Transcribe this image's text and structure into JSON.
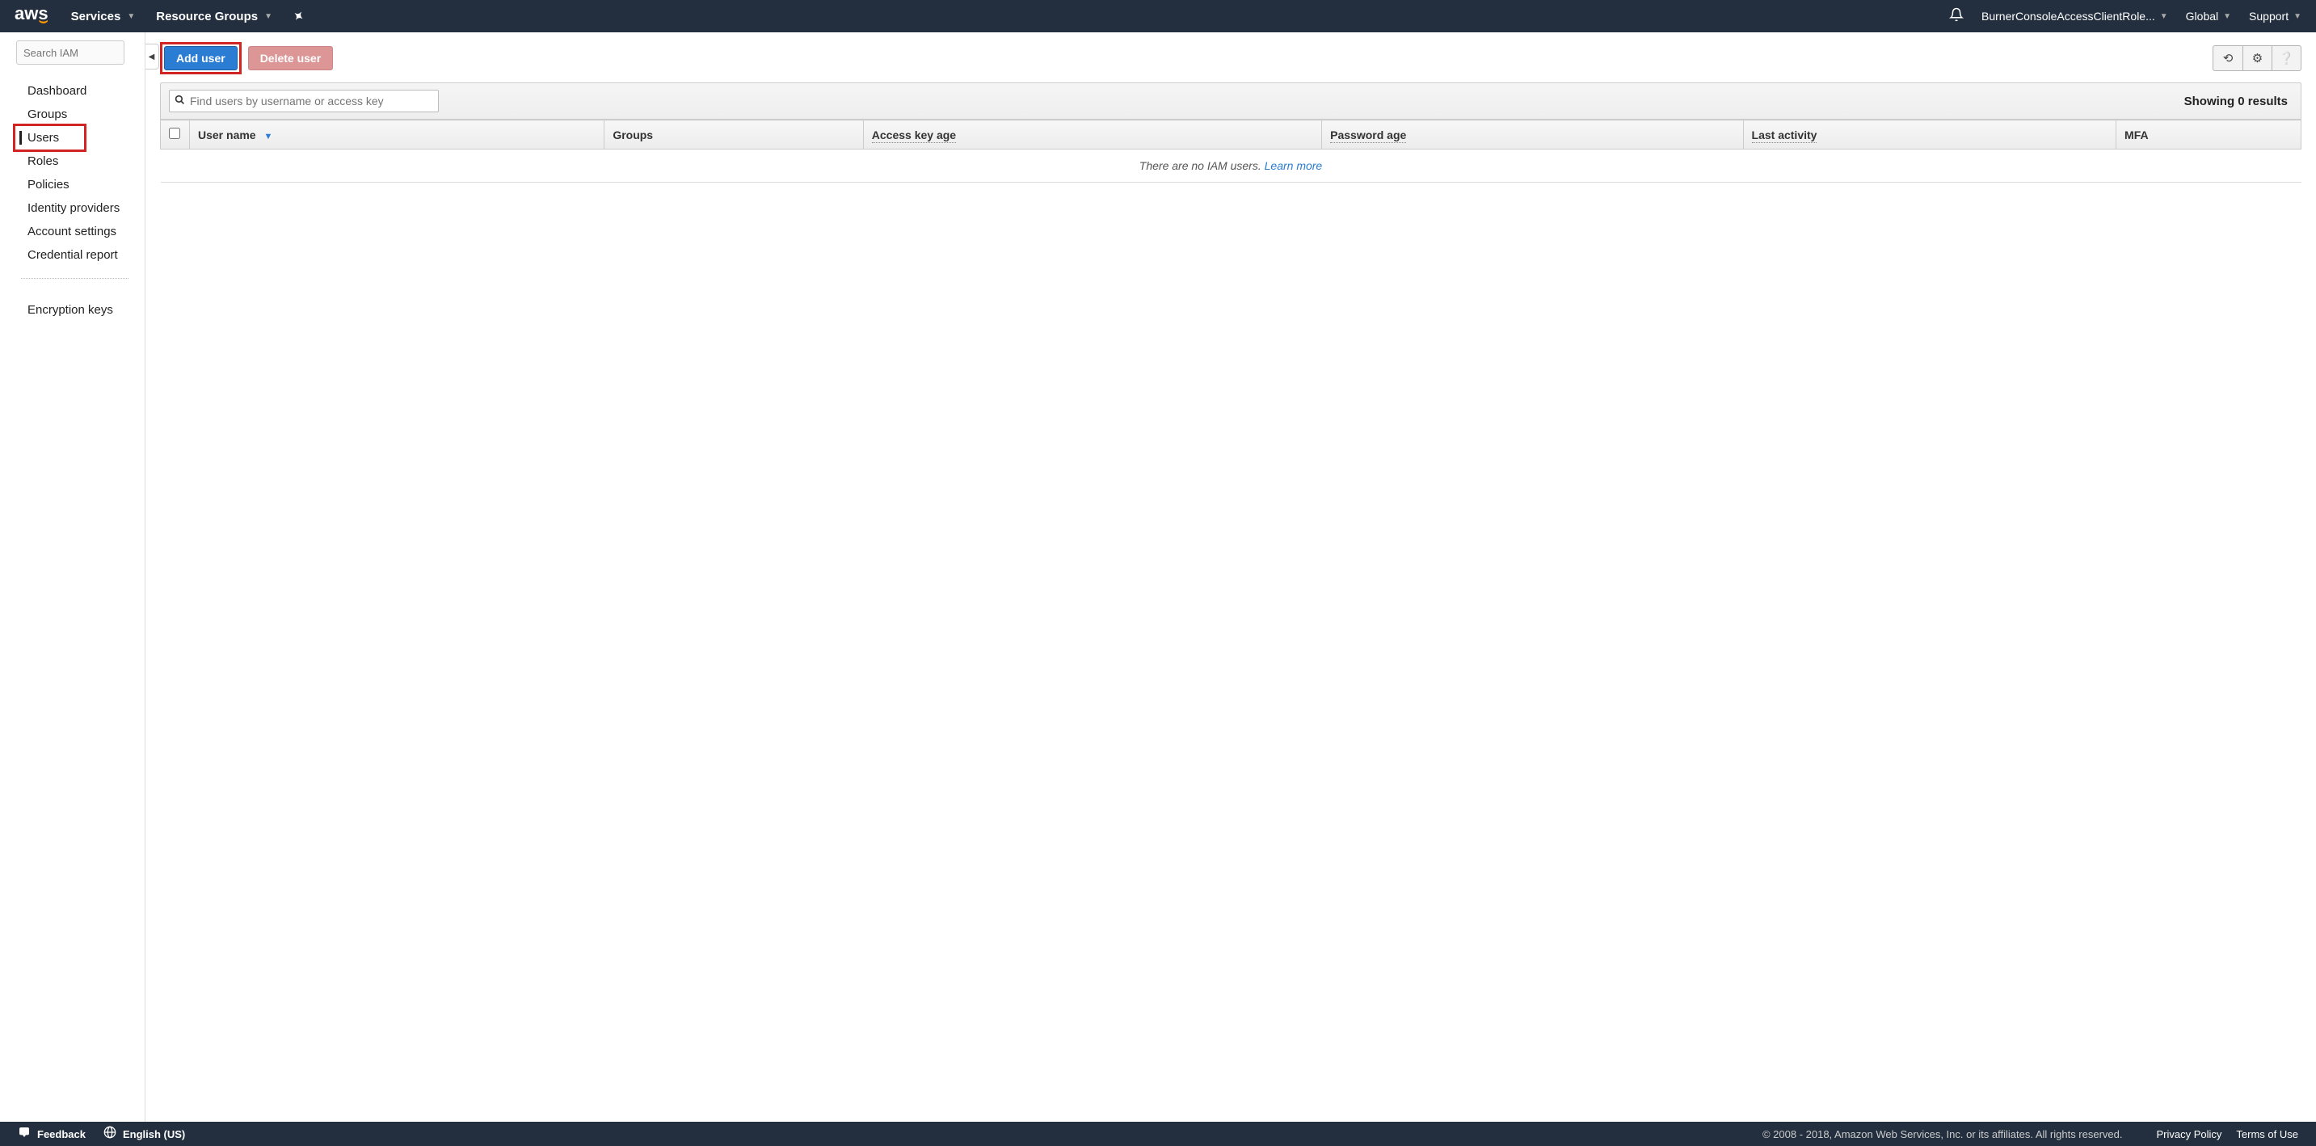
{
  "topnav": {
    "logo_text": "aws",
    "services": "Services",
    "resource_groups": "Resource Groups",
    "role": "BurnerConsoleAccessClientRole...",
    "region": "Global",
    "support": "Support"
  },
  "sidebar": {
    "search_placeholder": "Search IAM",
    "items": [
      {
        "label": "Dashboard"
      },
      {
        "label": "Groups"
      },
      {
        "label": "Users",
        "active": true,
        "highlighted": true
      },
      {
        "label": "Roles"
      },
      {
        "label": "Policies"
      },
      {
        "label": "Identity providers"
      },
      {
        "label": "Account settings"
      },
      {
        "label": "Credential report"
      }
    ],
    "below_divider": [
      {
        "label": "Encryption keys"
      }
    ]
  },
  "toolbar": {
    "add_user": "Add user",
    "delete_user": "Delete user"
  },
  "filter": {
    "search_placeholder": "Find users by username or access key",
    "results_text": "Showing 0 results"
  },
  "table": {
    "columns": {
      "user_name": "User name",
      "groups": "Groups",
      "access_key_age": "Access key age",
      "password_age": "Password age",
      "last_activity": "Last activity",
      "mfa": "MFA"
    },
    "empty_text": "There are no IAM users. ",
    "learn_more": "Learn more"
  },
  "footer": {
    "feedback": "Feedback",
    "language": "English (US)",
    "copyright": "© 2008 - 2018, Amazon Web Services, Inc. or its affiliates. All rights reserved.",
    "privacy": "Privacy Policy",
    "terms": "Terms of Use"
  }
}
